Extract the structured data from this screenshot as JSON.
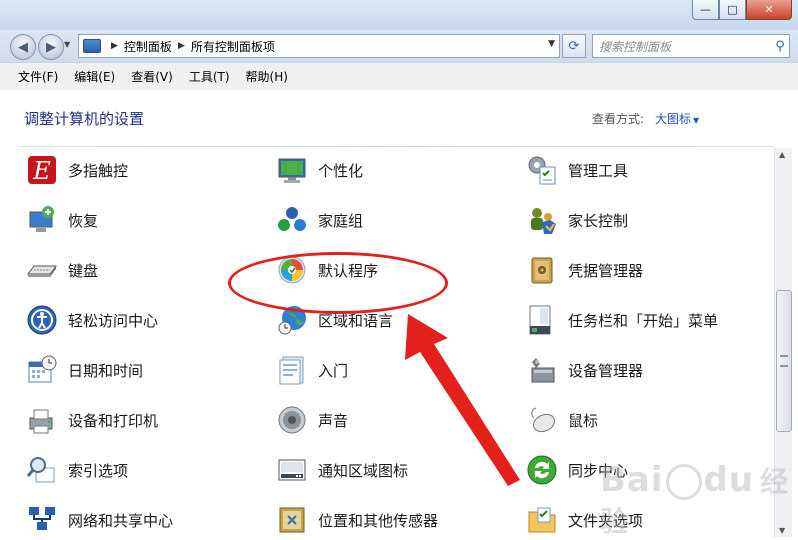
{
  "window": {
    "caption_min": "—",
    "caption_max": "□",
    "caption_close": "✕"
  },
  "address_bar": {
    "crumbs": [
      "控制面板",
      "所有控制面板项"
    ],
    "search_placeholder": "搜索控制面板"
  },
  "menu": [
    "文件(F)",
    "编辑(E)",
    "查看(V)",
    "工具(T)",
    "帮助(H)"
  ],
  "content": {
    "heading": "调整计算机的设置",
    "view_by_label": "查看方式:",
    "view_by_value": "大图标"
  },
  "items": [
    {
      "label": "多指触控",
      "icon": "multitouch-icon"
    },
    {
      "label": "个性化",
      "icon": "personalization-icon"
    },
    {
      "label": "管理工具",
      "icon": "admin-tools-icon"
    },
    {
      "label": "恢复",
      "icon": "recovery-icon"
    },
    {
      "label": "家庭组",
      "icon": "homegroup-icon"
    },
    {
      "label": "家长控制",
      "icon": "parental-controls-icon"
    },
    {
      "label": "键盘",
      "icon": "keyboard-icon"
    },
    {
      "label": "默认程序",
      "icon": "default-programs-icon"
    },
    {
      "label": "凭据管理器",
      "icon": "credential-manager-icon"
    },
    {
      "label": "轻松访问中心",
      "icon": "ease-of-access-icon"
    },
    {
      "label": "区域和语言",
      "icon": "region-language-icon"
    },
    {
      "label": "任务栏和「开始」菜单",
      "icon": "taskbar-icon"
    },
    {
      "label": "日期和时间",
      "icon": "date-time-icon"
    },
    {
      "label": "入门",
      "icon": "getting-started-icon"
    },
    {
      "label": "设备管理器",
      "icon": "device-manager-icon"
    },
    {
      "label": "设备和打印机",
      "icon": "devices-printers-icon"
    },
    {
      "label": "声音",
      "icon": "sound-icon"
    },
    {
      "label": "鼠标",
      "icon": "mouse-icon"
    },
    {
      "label": "索引选项",
      "icon": "indexing-options-icon"
    },
    {
      "label": "通知区域图标",
      "icon": "notification-area-icon"
    },
    {
      "label": "同步中心",
      "icon": "sync-center-icon"
    },
    {
      "label": "网络和共享中心",
      "icon": "network-sharing-icon"
    },
    {
      "label": "位置和其他传感器",
      "icon": "location-sensors-icon"
    },
    {
      "label": "文件夹选项",
      "icon": "folder-options-icon"
    }
  ],
  "watermark": {
    "brand": "Bai",
    "brand2": "du",
    "suffix": "经验"
  },
  "colors": {
    "heading": "#1e3287",
    "link": "#1f55b5",
    "annotation": "#e3201b"
  }
}
